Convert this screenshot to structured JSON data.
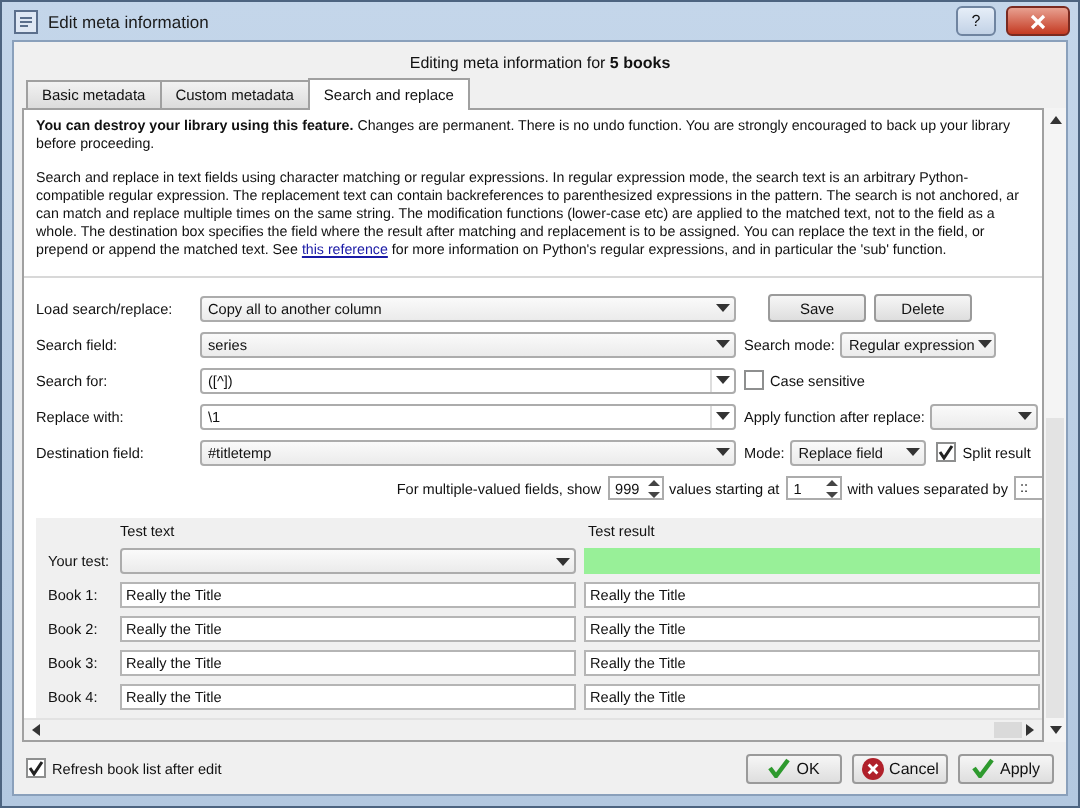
{
  "window": {
    "title": "Edit meta information",
    "help": "?"
  },
  "heading": "Editing meta information for **5 books**",
  "tabs": [
    {
      "label": "Basic metadata",
      "selected": false
    },
    {
      "label": "Custom metadata",
      "selected": false
    },
    {
      "label": "Search and replace",
      "selected": true
    }
  ],
  "warning": "**You can destroy your library using this feature.** Changes are permanent. There is no undo function. You are strongly encouraged to back up your library before proceeding.",
  "description": {
    "lines": [
      "Search and replace in text fields using character matching or regular expressions. In regular expression mode, the search text is an arbitrary Python-",
      "compatible regular expression. The replacement text can contain backreferences to parenthesized expressions in the pattern. The search is not anchored, ar",
      "can match and replace multiple times on the same string. The modification functions (lower-case etc) are applied to the matched text, not to the field as a",
      "whole. The destination box specifies the field where the result after matching and replacement is to be assigned. You can replace the text in the field, or"
    ],
    "last_line": {
      "before": "prepend or append the matched text. See",
      "link": "this reference",
      "after": "for more information on Python's regular expressions, and in particular the 'sub' function."
    }
  },
  "form": {
    "load": {
      "label": "Load search/replace:",
      "value": "Copy all to another column"
    },
    "save": "Save",
    "delete": "Delete",
    "search_field": {
      "label": "Search field:",
      "value": "series"
    },
    "search_mode": {
      "label": "Search mode:",
      "value": "Regular expression"
    },
    "search_for": {
      "label": "Search for:",
      "value": "([^])"
    },
    "case_sensitive": {
      "label": "Case sensitive",
      "checked": false
    },
    "replace_with": {
      "label": "Replace with:",
      "value": "\\1"
    },
    "apply_function": {
      "label": "Apply function after replace:"
    },
    "destination": {
      "label": "Destination field:",
      "value": "#titletemp"
    },
    "mode": {
      "label": "Mode:",
      "value": "Replace field"
    },
    "split_result": {
      "label": "Split result",
      "checked": true
    }
  },
  "multiple": {
    "label": "For multiple-valued fields, show",
    "show": "999",
    "starting_label": "values starting at",
    "start": "1",
    "separator_label": "with values separated by",
    "separator": "::"
  },
  "test": {
    "columns": [
      "Test text",
      "Test result"
    ],
    "your_test": "Your test:",
    "books": [
      {
        "label": "Book 1:",
        "text": "Really the Title",
        "result": "Really the Title"
      },
      {
        "label": "Book 2:",
        "text": "Really the Title",
        "result": "Really the Title"
      },
      {
        "label": "Book 3:",
        "text": "Really the Title",
        "result": "Really the Title"
      },
      {
        "label": "Book 4:",
        "text": "Really the Title",
        "result": "Really the Title"
      }
    ]
  },
  "refresh": {
    "label": "Refresh book list after edit",
    "checked": true
  },
  "buttons": [
    {
      "label": "OK",
      "kind": "confirm"
    },
    {
      "label": "Cancel",
      "kind": "cancel"
    },
    {
      "label": "Apply",
      "kind": "confirm"
    }
  ]
}
